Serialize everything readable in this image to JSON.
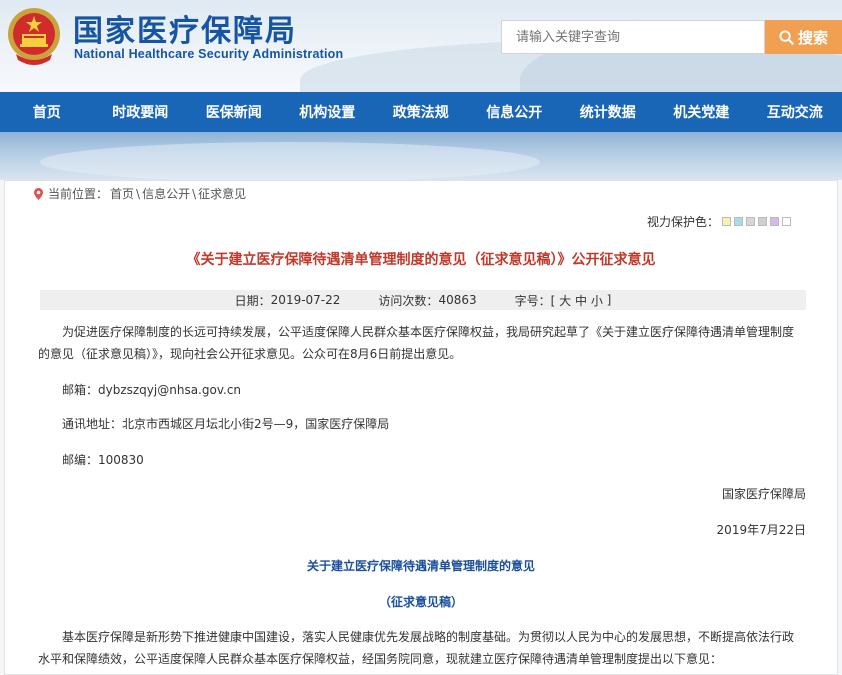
{
  "header": {
    "logo_cn": "国家医疗保障局",
    "logo_en": "National Healthcare Security Administration",
    "search_placeholder": "请输入关键字查询",
    "search_button": "搜索"
  },
  "nav": {
    "items": [
      {
        "label": "首页"
      },
      {
        "label": "时政要闻"
      },
      {
        "label": "医保新闻"
      },
      {
        "label": "机构设置"
      },
      {
        "label": "政策法规"
      },
      {
        "label": "信息公开"
      },
      {
        "label": "统计数据"
      },
      {
        "label": "机关党建"
      },
      {
        "label": "互动交流"
      }
    ]
  },
  "breadcrumb": {
    "prefix": "当前位置：",
    "home": "首页",
    "sep1": "\\",
    "section": "信息公开",
    "sep2": "\\",
    "current": "征求意见"
  },
  "visual_protect": {
    "label": "视力保护色：",
    "colors": [
      "#f7f2b3",
      "#a6dce8",
      "#d6d6d6",
      "#cfcfcf",
      "#d9b7e8",
      "#ffffff"
    ]
  },
  "article": {
    "title": "《关于建立医疗保障待遇清单管理制度的意见（征求意见稿）》公开征求意见",
    "meta": {
      "date_label": "日期：",
      "date": "2019-07-22",
      "visits_label": "访问次数：",
      "visits": "40863",
      "font_label": "字号：[ ",
      "font_large": "大",
      "font_medium": "中",
      "font_small": "小",
      "font_end": " ]"
    },
    "intro_line1": "为促进医疗保障制度的长远可持续发展，公平适度保障人民群众基本医疗保障权益，我局研究起草了《关于建立医疗保障待遇清单管理制度",
    "intro_line2": "的意见（征求意见稿）》，现向社会公开征求意见。公众可在8月6日前提出意见。",
    "email": "邮箱：dybzszqyj@nhsa.gov.cn",
    "address": "通讯地址：北京市西城区月坛北小街2号—9，国家医疗保障局",
    "postcode": "邮编：100830",
    "signature": "国家医疗保障局",
    "sign_date": "2019年7月22日",
    "doc_title": "关于建立医疗保障待遇清单管理制度的意见",
    "doc_subtitle": "（征求意见稿）",
    "body_line1": "基本医疗保障是新形势下推进健康中国建设，落实人民健康优先发展战略的制度基础。为贯彻以人民为中心的发展思想，不断提高依法行政",
    "body_line2": "水平和保障绩效，公平适度保障人民群众基本医疗保障权益，经国务院同意，现就建立医疗保障待遇清单管理制度提出以下意见："
  }
}
